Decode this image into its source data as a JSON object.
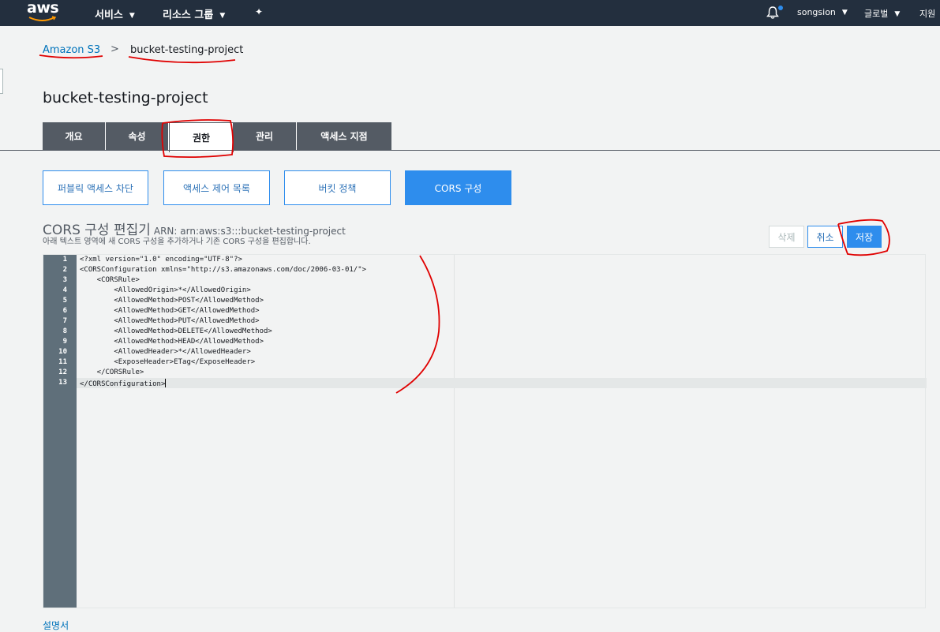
{
  "topnav": {
    "logo": "aws",
    "services": "서비스",
    "resource_groups": "리소스 그룹",
    "user": "songsion",
    "region": "글로벌",
    "support": "지원"
  },
  "breadcrumb": {
    "root": "Amazon S3",
    "separator": ">",
    "current": "bucket-testing-project"
  },
  "page_title": "bucket-testing-project",
  "tabs": [
    {
      "label": "개요"
    },
    {
      "label": "속성"
    },
    {
      "label": "권한"
    },
    {
      "label": "관리"
    },
    {
      "label": "액세스 지점"
    }
  ],
  "sub_tabs": [
    {
      "label": "퍼블릭 액세스 차단"
    },
    {
      "label": "액세스 제어 목록"
    },
    {
      "label": "버킷 정책"
    },
    {
      "label": "CORS 구성"
    }
  ],
  "editor": {
    "title": "CORS 구성 편집기",
    "arn": "ARN: arn:aws:s3:::bucket-testing-project",
    "description": "아래 텍스트 영역에 새 CORS 구성을 추가하거나 기존 CORS 구성을 편집합니다.",
    "delete_label": "삭제",
    "cancel_label": "취소",
    "save_label": "저장",
    "lines": [
      "<?xml version=\"1.0\" encoding=\"UTF-8\"?>",
      "<CORSConfiguration xmlns=\"http://s3.amazonaws.com/doc/2006-03-01/\">",
      "    <CORSRule>",
      "        <AllowedOrigin>*</AllowedOrigin>",
      "        <AllowedMethod>POST</AllowedMethod>",
      "        <AllowedMethod>GET</AllowedMethod>",
      "        <AllowedMethod>PUT</AllowedMethod>",
      "        <AllowedMethod>DELETE</AllowedMethod>",
      "        <AllowedMethod>HEAD</AllowedMethod>",
      "        <AllowedHeader>*</AllowedHeader>",
      "        <ExposeHeader>ETag</ExposeHeader>",
      "    </CORSRule>",
      "</CORSConfiguration>"
    ],
    "line_numbers": [
      "1",
      "2",
      "3",
      "4",
      "5",
      "6",
      "7",
      "8",
      "9",
      "10",
      "11",
      "12",
      "13"
    ]
  },
  "footer_link": "설명서",
  "colors": {
    "nav_bg": "#232f3e",
    "tab_bg": "#545b64",
    "accent": "#2e8ded",
    "annotation": "#e00000"
  }
}
